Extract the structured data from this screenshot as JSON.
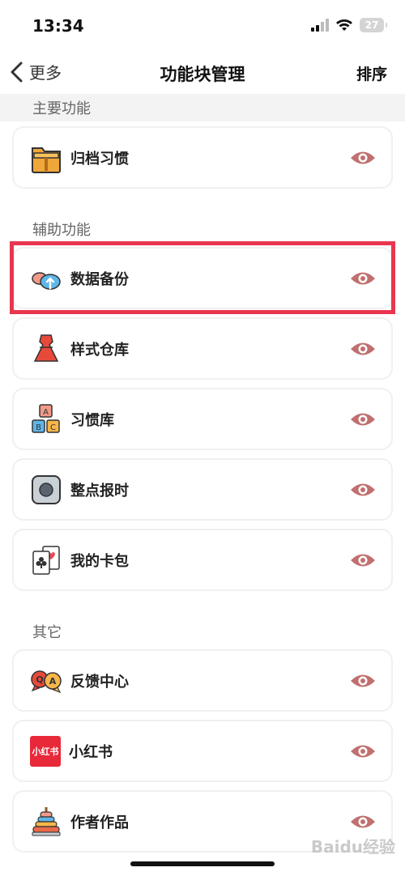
{
  "status": {
    "time": "13:34",
    "battery": "27"
  },
  "nav": {
    "back_label": "更多",
    "title": "功能块管理",
    "sort_label": "排序"
  },
  "sections": {
    "main": {
      "title": "主要功能"
    },
    "aux": {
      "title": "辅助功能"
    },
    "other": {
      "title": "其它"
    }
  },
  "items": {
    "archive": {
      "label": "归档习惯",
      "icon": "folder-icon"
    },
    "backup": {
      "label": "数据备份",
      "icon": "cloud-upload-icon"
    },
    "style": {
      "label": "样式仓库",
      "icon": "dress-icon"
    },
    "habits": {
      "label": "习惯库",
      "icon": "abc-blocks-icon"
    },
    "chime": {
      "label": "整点报时",
      "icon": "square-button-icon"
    },
    "cards": {
      "label": "我的卡包",
      "icon": "playing-cards-icon"
    },
    "feedback": {
      "label": "反馈中心",
      "icon": "qa-bubbles-icon"
    },
    "xhs": {
      "label": "小红书",
      "icon": "xiaohongshu-logo-icon",
      "logo_text": "小红书"
    },
    "works": {
      "label": "作者作品",
      "icon": "ring-stack-icon"
    }
  },
  "watermark": "Baidu经验",
  "colors": {
    "eye": "#c0706f",
    "highlight": "#e8364f",
    "xhs_red": "#e8293a"
  }
}
